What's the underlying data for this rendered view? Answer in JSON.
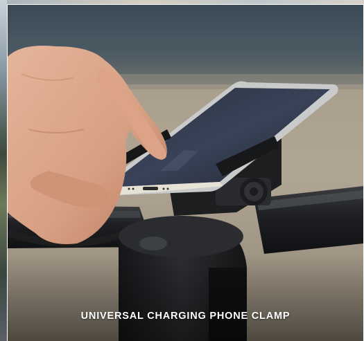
{
  "caption": {
    "text": "UNIVERSAL CHARGING PHONE CLAMP",
    "color": "#ffffff"
  },
  "photo": {
    "subject": "hand-tapping-phone-on-bike-handlebar-mount"
  }
}
